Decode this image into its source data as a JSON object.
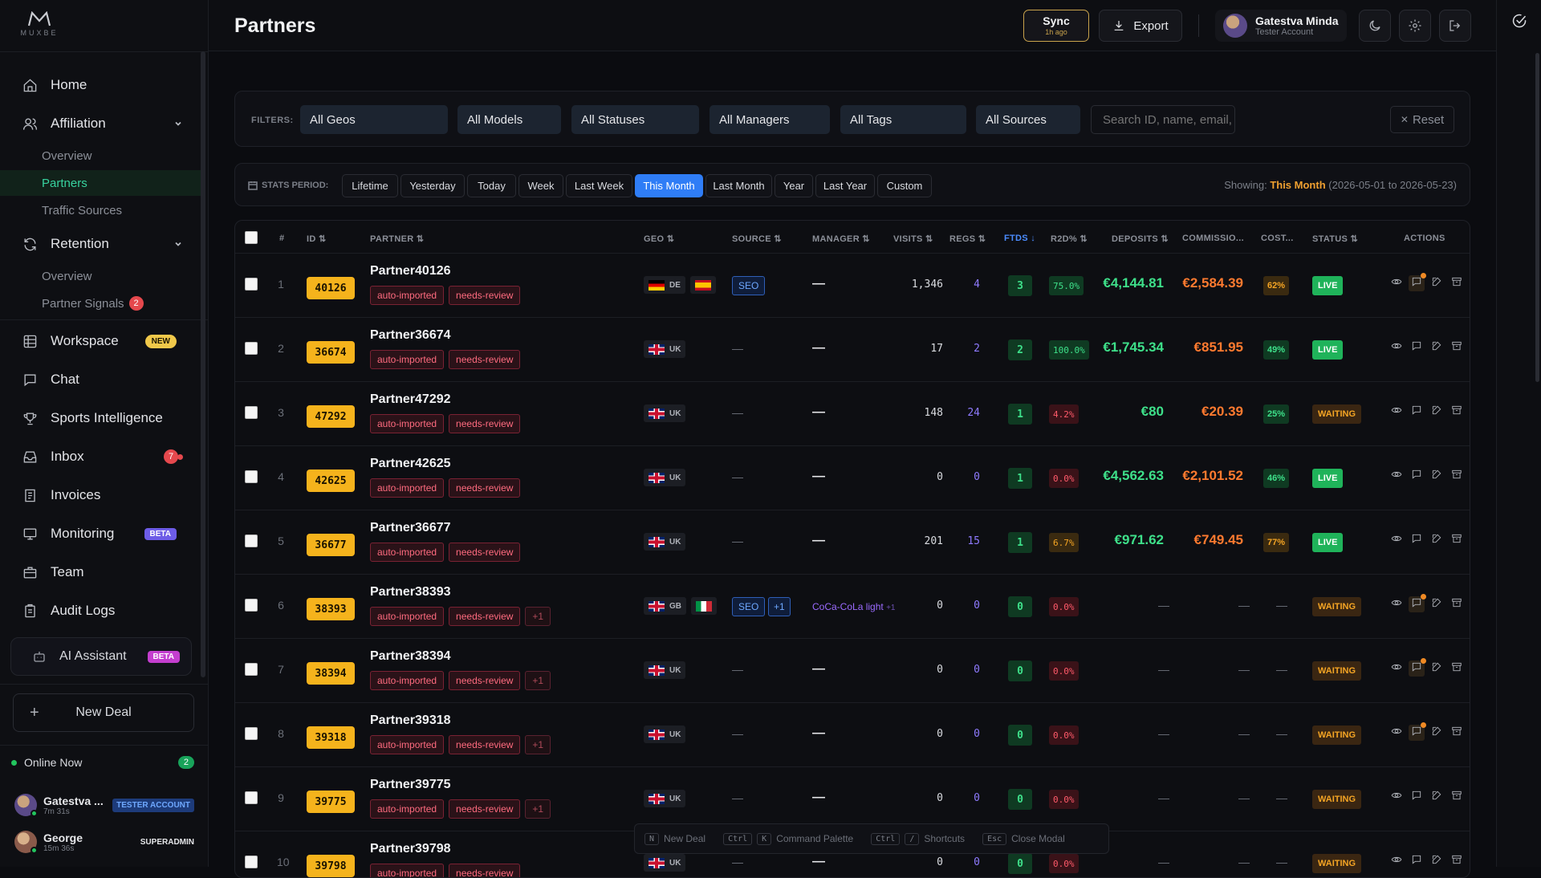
{
  "app": {
    "logo_text": "MUXBE",
    "page_title": "Partners"
  },
  "sidebar": {
    "nav": [
      {
        "label": "Home",
        "icon": "home-icon"
      },
      {
        "label": "Affiliation",
        "icon": "users-icon"
      },
      {
        "label": "Retention",
        "icon": "refresh-icon"
      },
      {
        "label": "Workspace",
        "icon": "grid-icon",
        "tag": "NEW"
      },
      {
        "label": "Chat",
        "icon": "chat-icon"
      },
      {
        "label": "Sports Intelligence",
        "icon": "trophy-icon"
      },
      {
        "label": "Inbox",
        "icon": "inbox-icon",
        "badge": "7"
      },
      {
        "label": "Invoices",
        "icon": "invoice-icon"
      },
      {
        "label": "Monitoring",
        "icon": "monitor-icon",
        "tag": "BETA"
      },
      {
        "label": "Team",
        "icon": "briefcase-icon"
      },
      {
        "label": "Audit Logs",
        "icon": "clipboard-icon"
      }
    ],
    "affiliation_sub": [
      "Overview",
      "Partners",
      "Traffic Sources"
    ],
    "retention_sub": [
      "Overview",
      "Partner Signals"
    ],
    "partner_signals_badge": "2",
    "ai_assistant": {
      "label": "AI Assistant",
      "tag": "BETA"
    },
    "new_deal": "New Deal",
    "online": {
      "label": "Online Now",
      "count": "2"
    },
    "users": [
      {
        "name": "Gatestva ...",
        "time": "7m 31s",
        "role": "TESTER ACCOUNT"
      },
      {
        "name": "George",
        "time": "15m 36s",
        "role": "SUPERADMIN"
      }
    ]
  },
  "header": {
    "sync": {
      "label": "Sync",
      "sub": "1h ago"
    },
    "export": "Export",
    "user": {
      "name": "Gatestva Minda",
      "role": "Tester Account"
    }
  },
  "filters": {
    "label": "FILTERS:",
    "selects": [
      "All Geos",
      "All Models",
      "All Statuses",
      "All Managers",
      "All Tags",
      "All Sources"
    ],
    "search_placeholder": "Search ID, name, email,",
    "reset": "Reset"
  },
  "period": {
    "label": "STATS PERIOD:",
    "options": [
      "Lifetime",
      "Yesterday",
      "Today",
      "Week",
      "Last Week",
      "This Month",
      "Last Month",
      "Year",
      "Last Year",
      "Custom"
    ],
    "active": "This Month",
    "showing_prefix": "Showing:",
    "showing_period": "This Month",
    "showing_range": "(2026-05-01 to 2026-05-23)"
  },
  "table": {
    "columns": [
      "#",
      "ID",
      "PARTNER",
      "GEO",
      "SOURCE",
      "MANAGER",
      "VISITS",
      "REGS",
      "FTDS",
      "R2D%",
      "DEPOSITS",
      "COMMISSIO...",
      "COST...",
      "STATUS",
      "ACTIONS"
    ],
    "rows": [
      {
        "n": "1",
        "id": "40126",
        "name": "Partner40126",
        "tags": [
          "auto-imported",
          "needs-review"
        ],
        "more": "",
        "geo": [
          {
            "code": "DE",
            "flag": "de"
          },
          {
            "code": "",
            "flag": "es"
          }
        ],
        "source": "SEO",
        "source_more": "",
        "manager": "—",
        "visits": "1,346",
        "regs": "4",
        "ftds": "3",
        "r2d": "75.0%",
        "r2d_state": "good",
        "deposits": "€4,144.81",
        "commission": "€2,584.39",
        "cost": "62%",
        "cost_state": "warn",
        "status": "LIVE",
        "msg_dot": true
      },
      {
        "n": "2",
        "id": "36674",
        "name": "Partner36674",
        "tags": [
          "auto-imported",
          "needs-review"
        ],
        "more": "",
        "geo": [
          {
            "code": "UK",
            "flag": "uk"
          }
        ],
        "source": "",
        "source_more": "",
        "manager": "—",
        "visits": "17",
        "regs": "2",
        "ftds": "2",
        "r2d": "100.0%",
        "r2d_state": "good",
        "deposits": "€1,745.34",
        "commission": "€851.95",
        "cost": "49%",
        "cost_state": "good",
        "status": "LIVE",
        "msg_dot": false
      },
      {
        "n": "3",
        "id": "47292",
        "name": "Partner47292",
        "tags": [
          "auto-imported",
          "needs-review"
        ],
        "more": "",
        "geo": [
          {
            "code": "UK",
            "flag": "uk"
          }
        ],
        "source": "",
        "source_more": "",
        "manager": "—",
        "visits": "148",
        "regs": "24",
        "ftds": "1",
        "r2d": "4.2%",
        "r2d_state": "bad",
        "deposits": "€80",
        "commission": "€20.39",
        "cost": "25%",
        "cost_state": "good",
        "status": "WAITING",
        "msg_dot": false
      },
      {
        "n": "4",
        "id": "42625",
        "name": "Partner42625",
        "tags": [
          "auto-imported",
          "needs-review"
        ],
        "more": "",
        "geo": [
          {
            "code": "UK",
            "flag": "uk"
          }
        ],
        "source": "",
        "source_more": "",
        "manager": "—",
        "visits": "0",
        "regs": "0",
        "ftds": "1",
        "r2d": "0.0%",
        "r2d_state": "bad",
        "deposits": "€4,562.63",
        "commission": "€2,101.52",
        "cost": "46%",
        "cost_state": "good",
        "status": "LIVE",
        "msg_dot": false
      },
      {
        "n": "5",
        "id": "36677",
        "name": "Partner36677",
        "tags": [
          "auto-imported",
          "needs-review"
        ],
        "more": "",
        "geo": [
          {
            "code": "UK",
            "flag": "uk"
          }
        ],
        "source": "",
        "source_more": "",
        "manager": "—",
        "visits": "201",
        "regs": "15",
        "ftds": "1",
        "r2d": "6.7%",
        "r2d_state": "warn",
        "deposits": "€971.62",
        "commission": "€749.45",
        "cost": "77%",
        "cost_state": "warn",
        "status": "LIVE",
        "msg_dot": false
      },
      {
        "n": "6",
        "id": "38393",
        "name": "Partner38393",
        "tags": [
          "auto-imported",
          "needs-review"
        ],
        "more": "+1",
        "geo": [
          {
            "code": "GB",
            "flag": "uk"
          },
          {
            "code": "",
            "flag": "it"
          }
        ],
        "source": "SEO",
        "source_more": "+1",
        "manager": "CoCa-CoLa light",
        "manager_more": "+1",
        "visits": "0",
        "regs": "0",
        "ftds": "0",
        "r2d": "0.0%",
        "r2d_state": "bad",
        "deposits": "—",
        "commission": "—",
        "cost": "—",
        "cost_state": "",
        "status": "WAITING",
        "msg_dot": true
      },
      {
        "n": "7",
        "id": "38394",
        "name": "Partner38394",
        "tags": [
          "auto-imported",
          "needs-review"
        ],
        "more": "+1",
        "geo": [
          {
            "code": "UK",
            "flag": "uk"
          }
        ],
        "source": "",
        "source_more": "",
        "manager": "—",
        "visits": "0",
        "regs": "0",
        "ftds": "0",
        "r2d": "0.0%",
        "r2d_state": "bad",
        "deposits": "—",
        "commission": "—",
        "cost": "—",
        "cost_state": "",
        "status": "WAITING",
        "msg_dot": true
      },
      {
        "n": "8",
        "id": "39318",
        "name": "Partner39318",
        "tags": [
          "auto-imported",
          "needs-review"
        ],
        "more": "+1",
        "geo": [
          {
            "code": "UK",
            "flag": "uk"
          }
        ],
        "source": "",
        "source_more": "",
        "manager": "—",
        "visits": "0",
        "regs": "0",
        "ftds": "0",
        "r2d": "0.0%",
        "r2d_state": "bad",
        "deposits": "—",
        "commission": "—",
        "cost": "—",
        "cost_state": "",
        "status": "WAITING",
        "msg_dot": true
      },
      {
        "n": "9",
        "id": "39775",
        "name": "Partner39775",
        "tags": [
          "auto-imported",
          "needs-review"
        ],
        "more": "+1",
        "geo": [
          {
            "code": "UK",
            "flag": "uk"
          }
        ],
        "source": "",
        "source_more": "",
        "manager": "—",
        "visits": "0",
        "regs": "0",
        "ftds": "0",
        "r2d": "0.0%",
        "r2d_state": "bad",
        "deposits": "—",
        "commission": "—",
        "cost": "—",
        "cost_state": "",
        "status": "WAITING",
        "msg_dot": false
      },
      {
        "n": "10",
        "id": "39798",
        "name": "Partner39798",
        "tags": [
          "auto-imported",
          "needs-review"
        ],
        "more": "",
        "geo": [
          {
            "code": "UK",
            "flag": "uk"
          }
        ],
        "source": "",
        "source_more": "",
        "manager": "—",
        "visits": "0",
        "regs": "0",
        "ftds": "0",
        "r2d": "0.0%",
        "r2d_state": "bad",
        "deposits": "—",
        "commission": "—",
        "cost": "—",
        "cost_state": "",
        "status": "WAITING",
        "msg_dot": false
      }
    ]
  },
  "shortcuts": [
    {
      "keys": [
        "N"
      ],
      "label": "New Deal"
    },
    {
      "keys": [
        "Ctrl",
        "K"
      ],
      "label": "Command Palette"
    },
    {
      "keys": [
        "Ctrl",
        "/"
      ],
      "label": "Shortcuts"
    },
    {
      "keys": [
        "Esc"
      ],
      "label": "Close Modal"
    }
  ],
  "colors": {
    "accent": "#2f7df6",
    "id_badge": "#f5b31c",
    "live": "#1fb35a",
    "waiting": "#f5a524",
    "deposit": "#3ee08a",
    "commission": "#ff7a2f",
    "tag": "#ff6b7f"
  }
}
